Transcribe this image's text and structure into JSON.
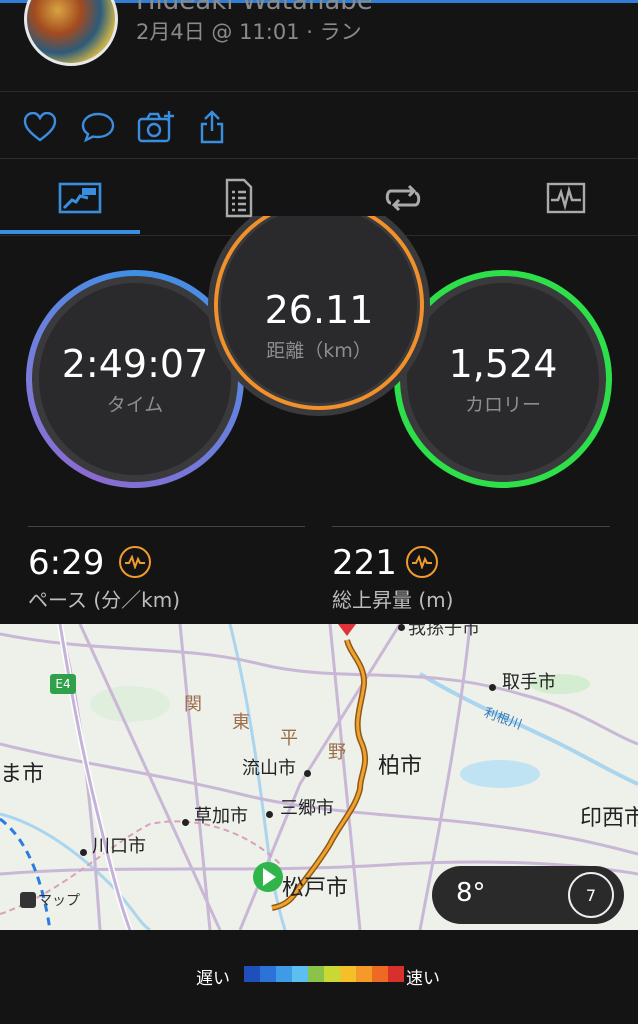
{
  "header": {
    "user_name": "Hideaki Watanabe",
    "subtitle": "2月4日 @ 11:01 · ラン"
  },
  "actions": {
    "like_icon": "heart-icon",
    "comment_icon": "comment-icon",
    "photo_icon": "add-photo-icon",
    "share_icon": "share-icon"
  },
  "tabs": [
    {
      "icon": "overview-map-icon",
      "active": true
    },
    {
      "icon": "details-list-icon",
      "active": false
    },
    {
      "icon": "laps-loop-icon",
      "active": false
    },
    {
      "icon": "charts-icon",
      "active": false
    }
  ],
  "rings": {
    "time": {
      "value": "2:49:07",
      "label": "タイム"
    },
    "distance": {
      "value": "26.11",
      "label": "距離（km）"
    },
    "calories": {
      "value": "1,524",
      "label": "カロリー"
    }
  },
  "stats": {
    "pace": {
      "value": "6:29",
      "label": "ペース (分／km)"
    },
    "elevation": {
      "value": "221",
      "label": "総上昇量 (m)"
    }
  },
  "map": {
    "labels": {
      "toride": "取手市",
      "kashiwa": "柏市",
      "nagareyama": "流山市",
      "misato": "三郷市",
      "soka": "草加市",
      "kawaguchi": "川口市",
      "matsudo": "松戸市",
      "inzai": "印西市",
      "saitama": "ま市",
      "kanto_plain": [
        "関",
        "東",
        "平",
        "野"
      ],
      "tone_river": "利根川",
      "road": "E4",
      "attribution": "マップ",
      "top_city": "我孫子市"
    },
    "weather": {
      "temp": "8°",
      "wind": "7"
    }
  },
  "legend": {
    "slow": "遅い",
    "fast": "速い",
    "colors": [
      "#1f4fb8",
      "#2b73d8",
      "#3f9be8",
      "#5bc0f0",
      "#8ac34a",
      "#c8d834",
      "#f4c02a",
      "#f59a2a",
      "#ee6a24",
      "#d8302a"
    ]
  }
}
